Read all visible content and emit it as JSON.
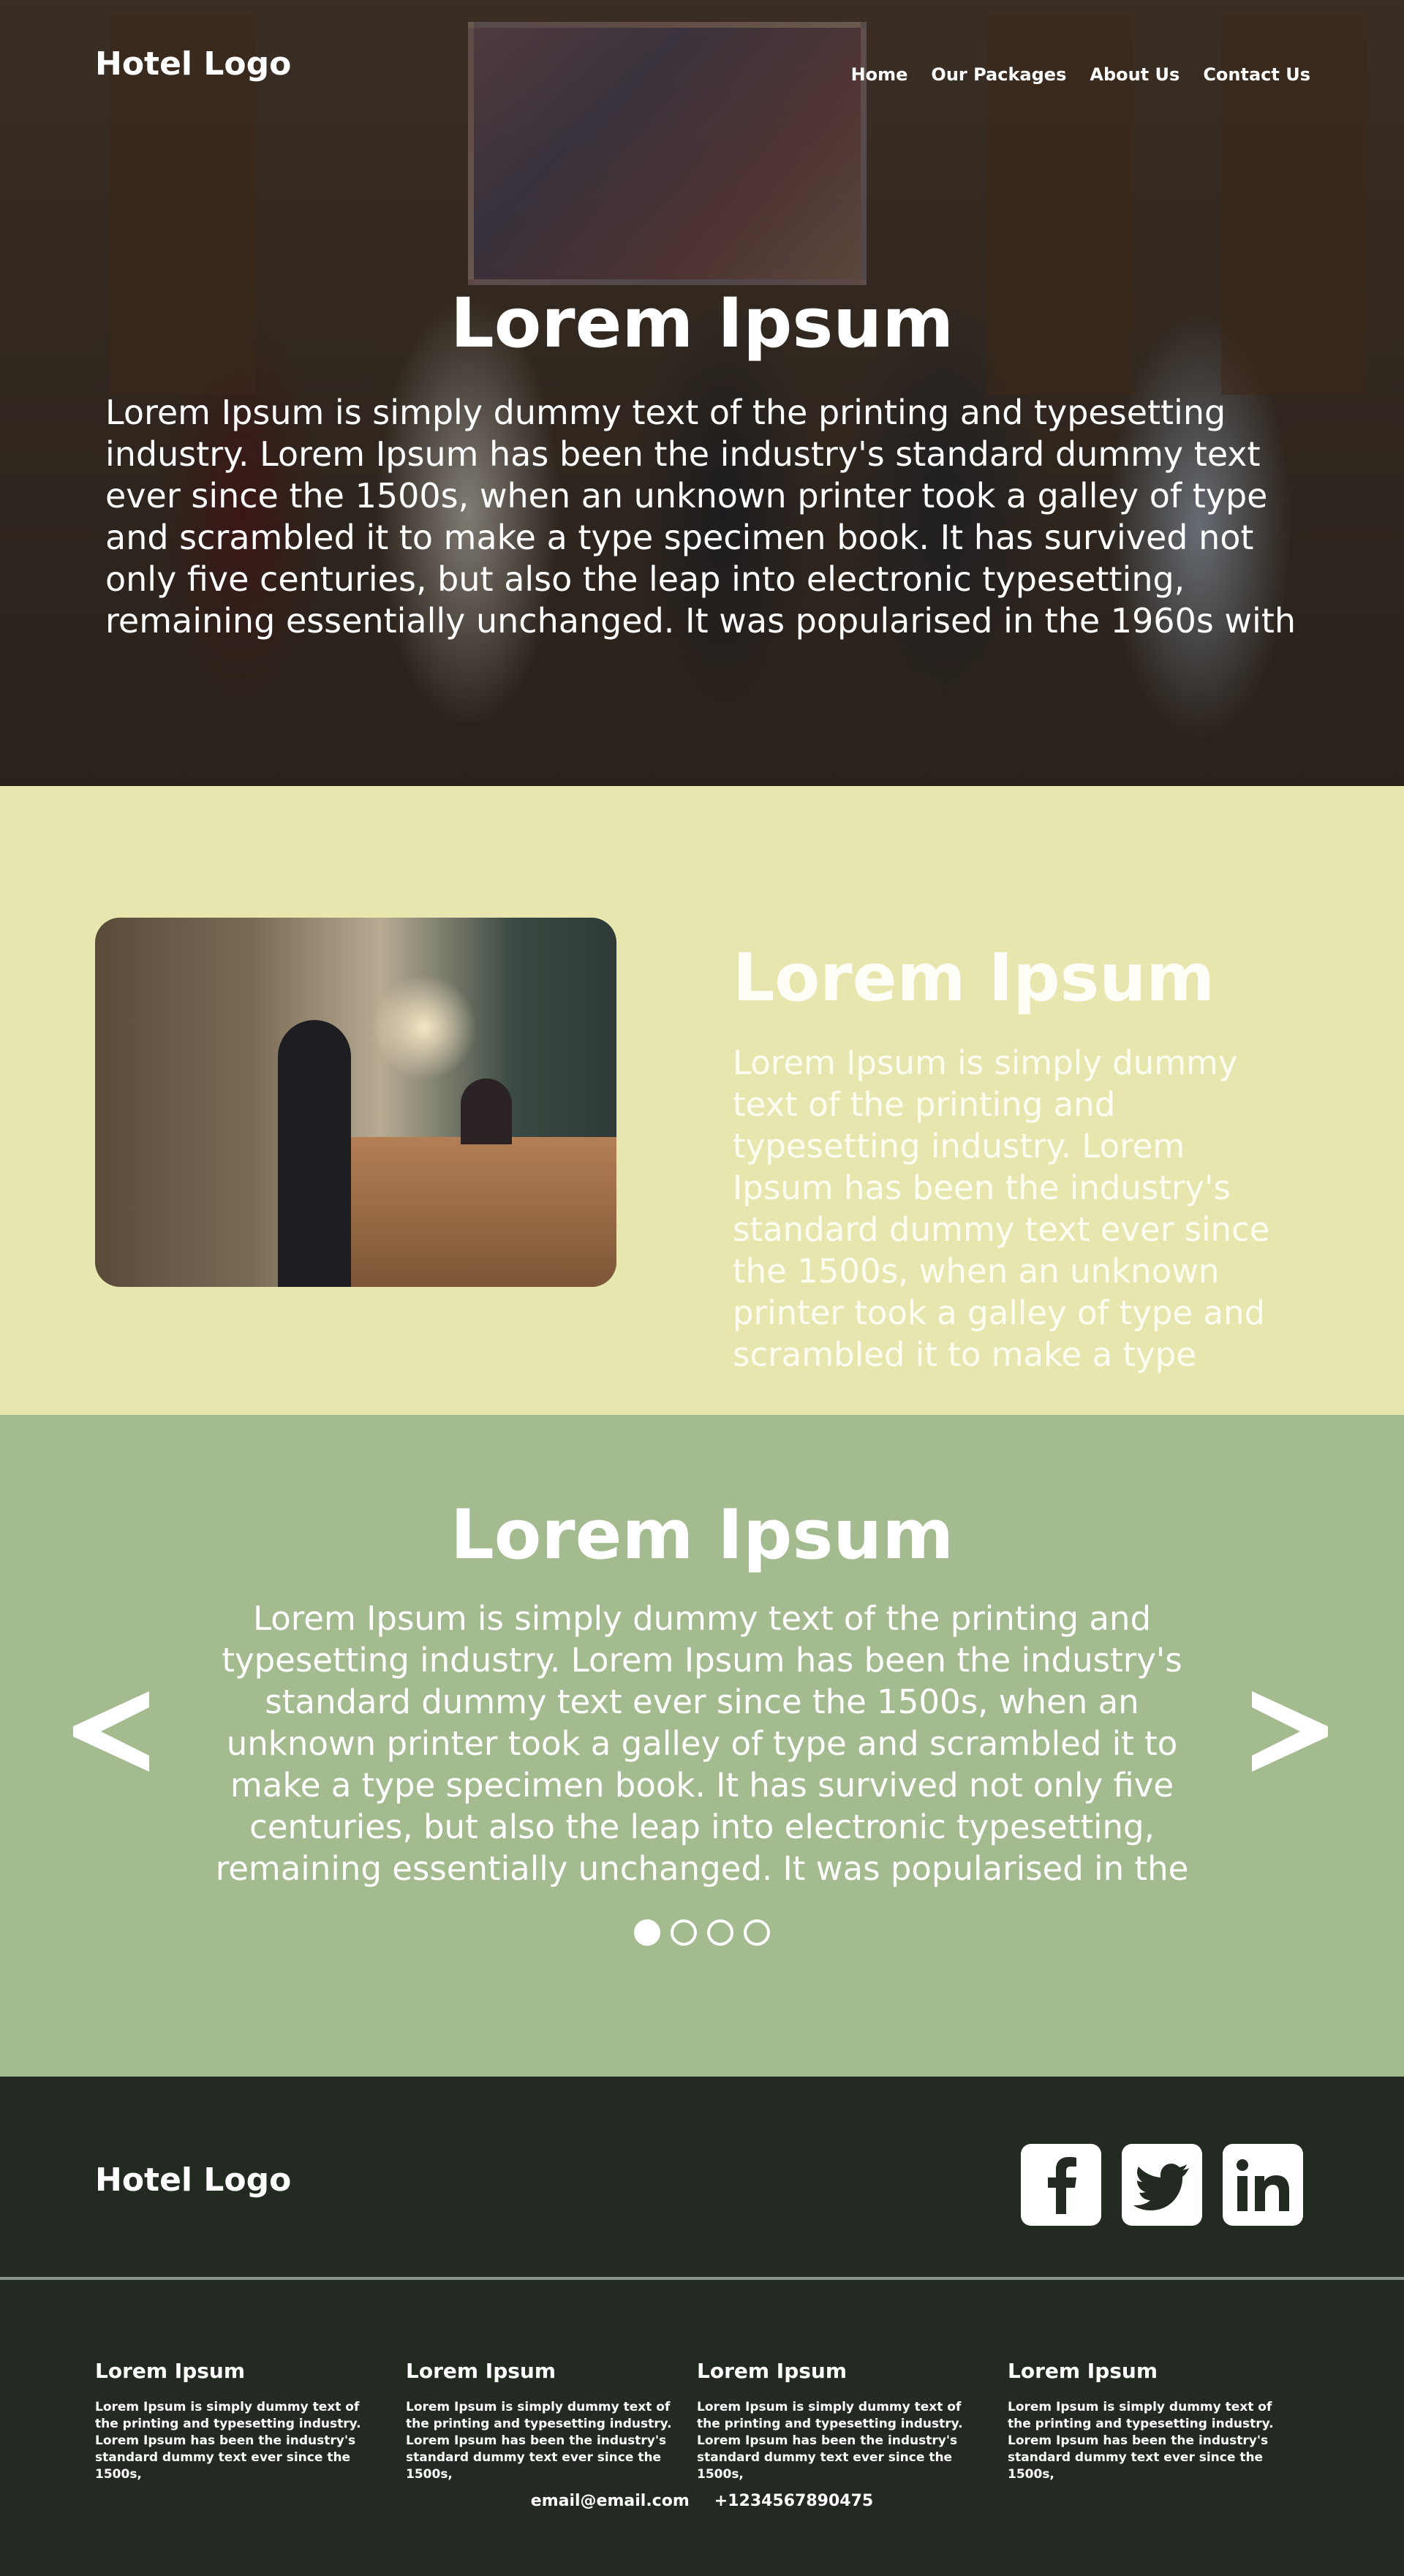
{
  "header": {
    "logo": "Hotel Logo",
    "nav": [
      "Home",
      "Our Packages",
      "About Us",
      "Contact Us"
    ]
  },
  "hero": {
    "title": "Lorem Ipsum",
    "text": "Lorem Ipsum is simply dummy text of the printing and typesetting industry. Lorem Ipsum has been the industry's standard dummy text ever since the 1500s, when an unknown printer took a galley of type and scrambled it to make a type specimen book. It has survived not only five centuries, but also the leap into electronic typesetting, remaining essentially unchanged. It was popularised in the 1960s with"
  },
  "about": {
    "title": "Lorem Ipsum",
    "text": "Lorem Ipsum is simply dummy text of the printing and typesetting industry. Lorem Ipsum has been the industry's standard dummy text ever since the 1500s, when an unknown printer took a galley of type and scrambled it to make a type"
  },
  "slider": {
    "title": "Lorem Ipsum",
    "text": "Lorem Ipsum is simply dummy text of the printing and typesetting industry. Lorem Ipsum has been the industry's standard dummy text ever since the 1500s, when an unknown printer took a galley of type and scrambled it to make a type specimen book. It has survived not only five centuries, but also the leap into electronic typesetting, remaining essentially unchanged. It was popularised in the",
    "prev_icon": "chevron-left-icon",
    "next_icon": "chevron-right-icon",
    "dot_count": 4,
    "active_dot": 1
  },
  "footer": {
    "logo": "Hotel Logo",
    "social": [
      "facebook-icon",
      "twitter-icon",
      "linkedin-icon"
    ],
    "columns": [
      {
        "title": "Lorem Ipsum",
        "text": "Lorem Ipsum is simply dummy text of the printing and typesetting industry. Lorem Ipsum has been the industry's standard dummy text ever since the 1500s,"
      },
      {
        "title": "Lorem Ipsum",
        "text": "Lorem Ipsum is simply dummy text of the printing and typesetting industry. Lorem Ipsum has been the industry's standard dummy text ever since the 1500s,"
      },
      {
        "title": "Lorem Ipsum",
        "text": "Lorem Ipsum is simply dummy text of the printing and typesetting industry. Lorem Ipsum has been the industry's standard dummy text ever since the 1500s,"
      },
      {
        "title": "Lorem Ipsum",
        "text": "Lorem Ipsum is simply dummy text of the printing and typesetting industry. Lorem Ipsum has been the industry's standard dummy text ever since the 1500s,"
      }
    ],
    "email": "email@email.com",
    "phone": "+1234567890475"
  },
  "colors": {
    "about_bg": "#e8e6af",
    "slider_bg": "#a4bb8f",
    "footer_bg": "#222a22"
  }
}
